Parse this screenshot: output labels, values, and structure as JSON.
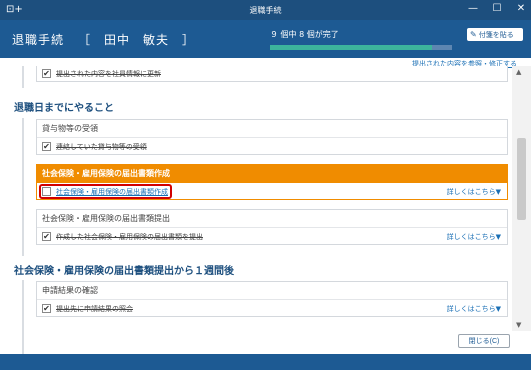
{
  "window": {
    "title": "退職手続",
    "left_icon": "back-add-icon"
  },
  "header": {
    "title": "退職手続",
    "employee_name": "［　田中　敏夫　］",
    "progress_text": "９ 個中 8 個が完了",
    "progress_fraction": 0.89,
    "sticky_button_label": "付箋を貼る"
  },
  "top_link": "提出された内容を参照・修正する",
  "items": {
    "update_employee_info": "提出された内容を社員情報に更新",
    "loaned_items_title": "貸与物等の受領",
    "loaned_items_row": "連絡していた貸与物等の受領",
    "social_insurance_docs_title": "社会保険・雇用保険の届出書類作成",
    "social_insurance_docs_row": "社会保険・雇用保険の届出書類作成",
    "social_insurance_submit_title": "社会保険・雇用保険の届出書類提出",
    "social_insurance_submit_row": "作成した社会保険・雇用保険の届出書類を提出",
    "application_result_title": "申請結果の確認",
    "application_result_row": "提出先に申請結果の照会"
  },
  "sections": {
    "until_retirement": "退職日までにやること",
    "after_submission": "社会保険・雇用保険の届出書類提出から１週間後"
  },
  "more_link": "詳しくはこちら▼",
  "close_button": "閉じる(C)",
  "colors": {
    "header_bg": "#1d5a93",
    "accent_orange": "#f08c00",
    "highlight_red": "#d10000",
    "link_blue": "#1a6fb5"
  }
}
